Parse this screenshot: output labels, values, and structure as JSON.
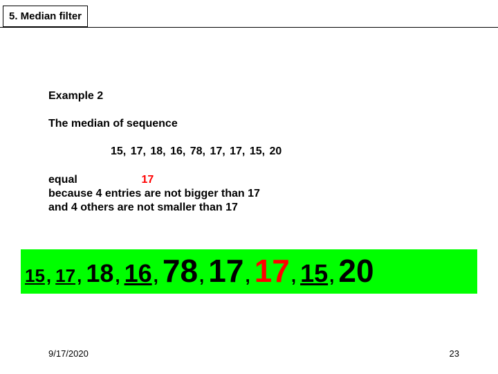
{
  "title": "5. Median filter",
  "example_label": "Example 2",
  "intro": "The median of sequence",
  "sequence_text": "15,  17,  18,  16,   78,   17,   17,   15,   20",
  "explain": {
    "equal_label": "equal",
    "equal_value": "17",
    "line2": "because 4 entries are not bigger than  17",
    "line3": "and  4 others are not smaller than  17"
  },
  "big_numbers": [
    {
      "val": "15",
      "style": "sz-s"
    },
    {
      "val": "17",
      "style": "sz-s"
    },
    {
      "val": "18",
      "style": "sz-m"
    },
    {
      "val": "16",
      "style": "sz-m ul"
    },
    {
      "val": "78",
      "style": "sz-l"
    },
    {
      "val": "17",
      "style": "sz-l"
    },
    {
      "val": "17",
      "style": "sz-l red"
    },
    {
      "val": "15",
      "style": "sz-m ul"
    },
    {
      "val": "20",
      "style": "sz-l"
    }
  ],
  "footer": {
    "date": "9/17/2020",
    "page": "23"
  },
  "chart_data": {
    "type": "table",
    "description": "sequence of 9 integers for median computation",
    "values": [
      15,
      17,
      18,
      16,
      78,
      17,
      17,
      15,
      20
    ],
    "median": 17
  }
}
